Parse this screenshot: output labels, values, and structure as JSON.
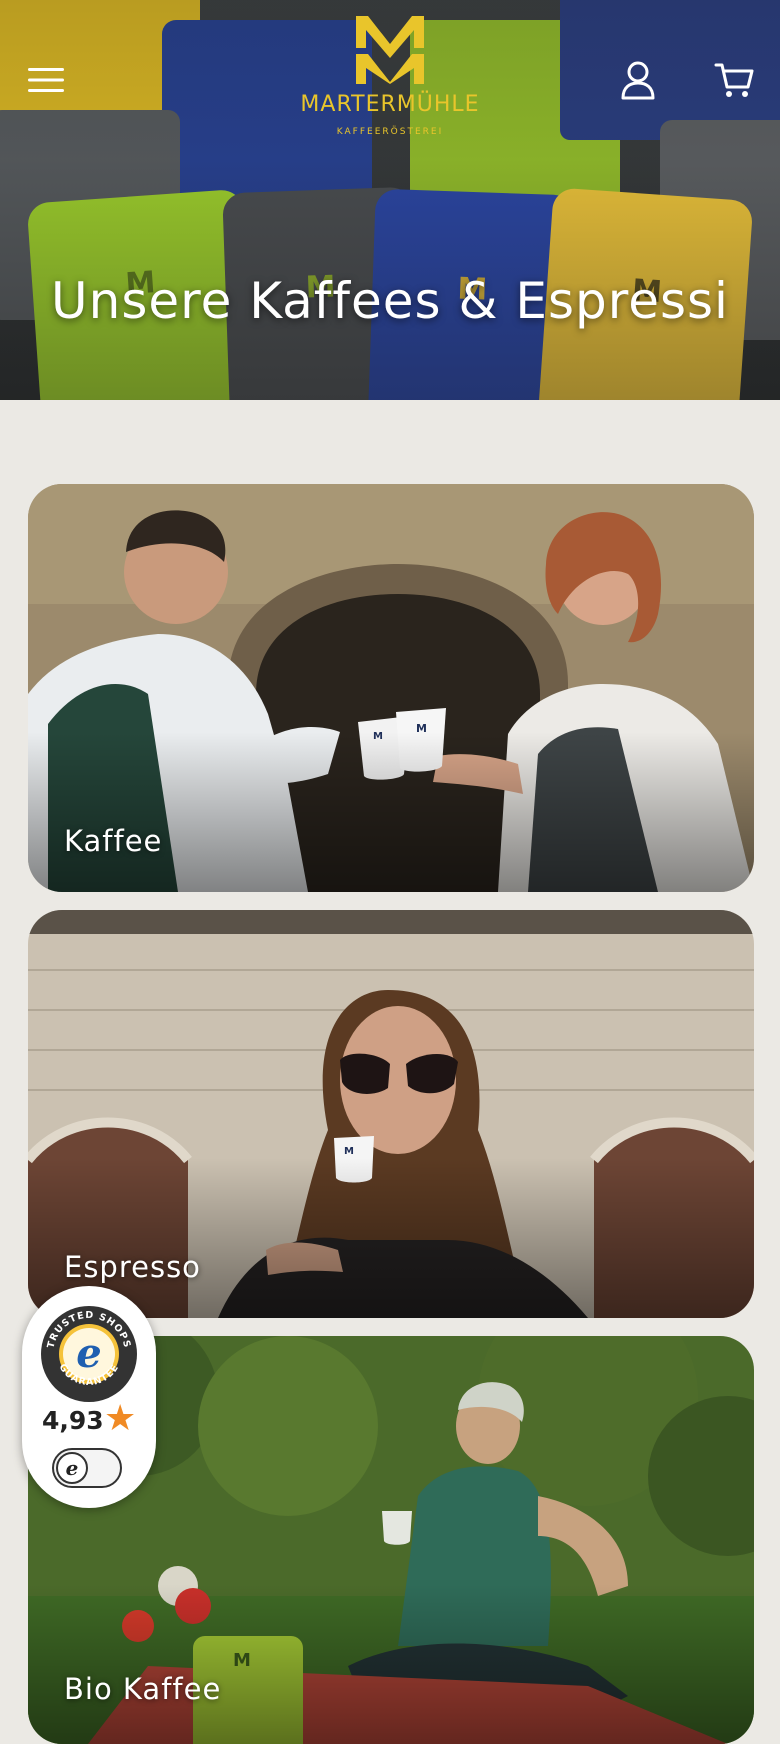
{
  "header": {
    "brand_name": "MARTERMÜHLE",
    "brand_sub": "KAFFEERÖSTEREI",
    "menu_icon": "hamburger-menu-icon",
    "account_icon": "user-account-icon",
    "cart_icon": "shopping-cart-icon"
  },
  "hero": {
    "title": "Unsere Kaffees & Espressi"
  },
  "categories": [
    {
      "label": "Kaffee"
    },
    {
      "label": "Espresso"
    },
    {
      "label": "Bio Kaffee"
    }
  ],
  "trusted_shops": {
    "seal_text": "TRUSTED SHOPS GUARANTEE",
    "rating": "4,93",
    "toggle_icon": "e"
  },
  "colors": {
    "background": "#ebe9e4",
    "brand_gold": "#e9c52b",
    "star": "#f08a24"
  }
}
